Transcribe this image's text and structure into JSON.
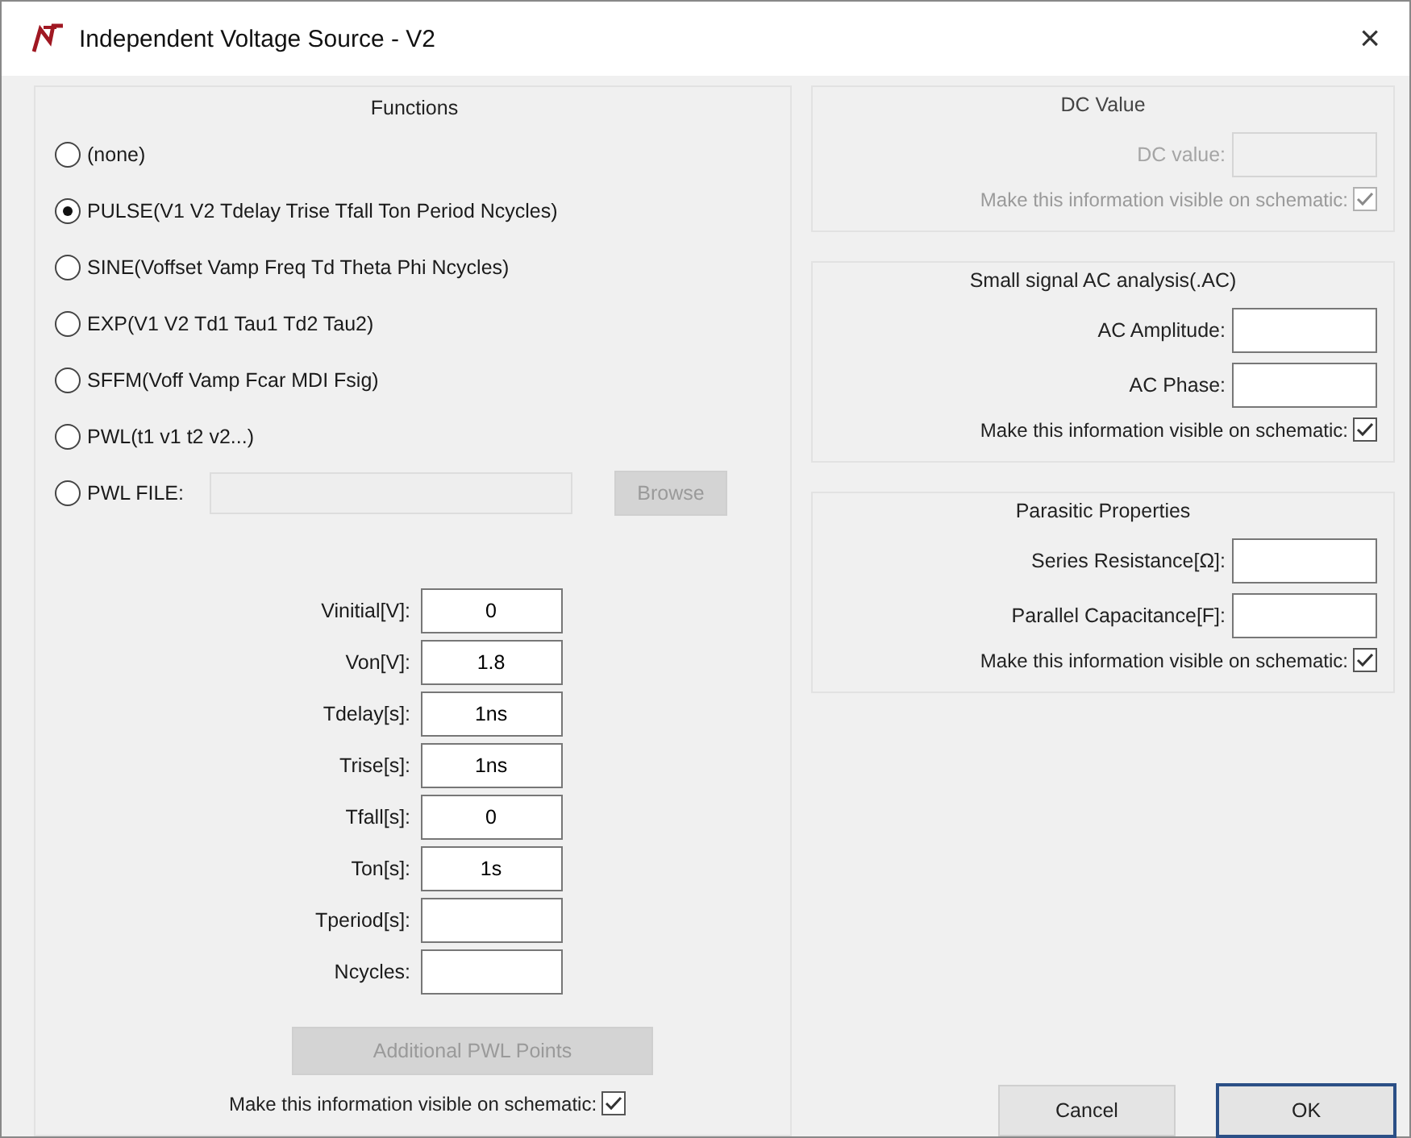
{
  "window": {
    "title": "Independent Voltage Source - V2",
    "close": "×"
  },
  "functions": {
    "title": "Functions",
    "options": [
      {
        "kind": "radio",
        "label": "(none)",
        "selected": false
      },
      {
        "kind": "radio",
        "label": "PULSE(V1 V2 Tdelay Trise Tfall Ton Period Ncycles)",
        "selected": true
      },
      {
        "kind": "radio",
        "label": "SINE(Voffset Vamp Freq Td Theta Phi Ncycles)",
        "selected": false
      },
      {
        "kind": "radio",
        "label": "EXP(V1 V2 Td1 Tau1 Td2 Tau2)",
        "selected": false
      },
      {
        "kind": "radio",
        "label": "SFFM(Voff Vamp Fcar MDI Fsig)",
        "selected": false
      },
      {
        "kind": "radio",
        "label": "PWL(t1 v1 t2 v2...)",
        "selected": false
      },
      {
        "kind": "file",
        "label": "PWL FILE:",
        "selected": false,
        "browse": "Browse",
        "disabled": true
      }
    ],
    "parameters": [
      {
        "label": "Vinitial[V]:",
        "value": "0"
      },
      {
        "label": "Von[V]:",
        "value": "1.8"
      },
      {
        "label": "Tdelay[s]:",
        "value": "1ns"
      },
      {
        "label": "Trise[s]:",
        "value": "1ns"
      },
      {
        "label": "Tfall[s]:",
        "value": "0"
      },
      {
        "label": "Ton[s]:",
        "value": "1s"
      },
      {
        "label": "Tperiod[s]:"
      },
      {
        "label": "Ncycles:"
      }
    ],
    "additional_button": {
      "label": "Additional PWL Points",
      "disabled": true
    },
    "visible_check": {
      "label": "Make this information visible on schematic:",
      "checked": true
    }
  },
  "groups": [
    {
      "title": "DC Value",
      "disabled": true,
      "fields": [
        {
          "label": "DC value:"
        }
      ],
      "check": {
        "label": "Make this information visible on schematic:",
        "checked": true
      }
    },
    {
      "title": "Small signal AC analysis(.AC)",
      "disabled": false,
      "fields": [
        {
          "label": "AC Amplitude:"
        },
        {
          "label": "AC Phase:"
        }
      ],
      "check": {
        "label": "Make this information visible on schematic:",
        "checked": true
      }
    },
    {
      "title": "Parasitic Properties",
      "disabled": false,
      "fields": [
        {
          "label": "Series Resistance[Ω]:"
        },
        {
          "label": "Parallel Capacitance[F]:"
        }
      ],
      "check": {
        "label": "Make this information visible on schematic:",
        "checked": true
      }
    }
  ],
  "buttons": [
    {
      "label": "Cancel",
      "default": false
    },
    {
      "label": "OK",
      "default": true
    }
  ]
}
